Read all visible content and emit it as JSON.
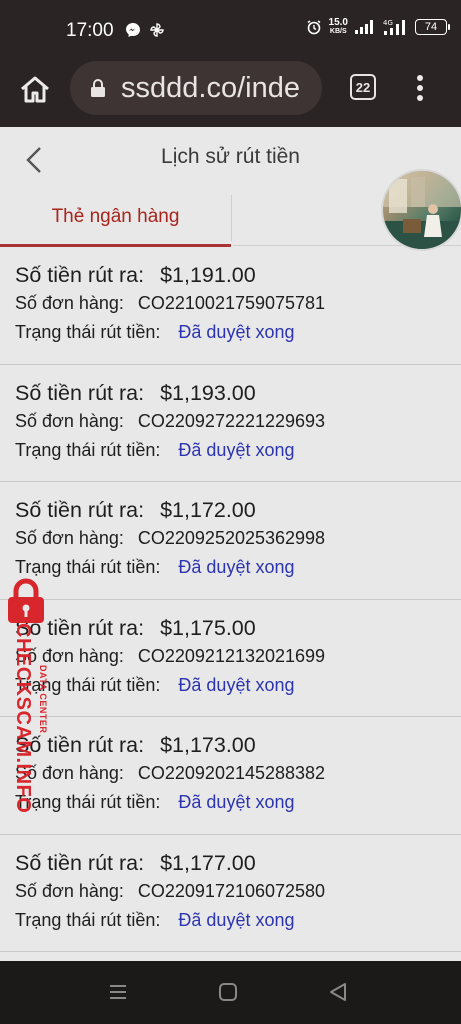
{
  "status_bar": {
    "time": "17:00",
    "net_speed": "15.0",
    "net_unit": "KB/S",
    "battery": "74"
  },
  "browser": {
    "url": "ssddd.co/inde",
    "tab_count": "22"
  },
  "header": {
    "title": "Lịch sử rút tiền"
  },
  "tabs": [
    {
      "label": "Thẻ ngân hàng",
      "active": true
    }
  ],
  "labels": {
    "amount": "Số tiền rút ra:",
    "order": "Số đơn hàng:",
    "status": "Trạng thái rút tiền:"
  },
  "withdrawals": [
    {
      "amount": "$1,191.00",
      "order": "CO2210021759075781",
      "status": "Đã duyệt xong"
    },
    {
      "amount": "$1,193.00",
      "order": "CO2209272221229693",
      "status": "Đã duyệt xong"
    },
    {
      "amount": "$1,172.00",
      "order": "CO2209252025362998",
      "status": "Đã duyệt xong"
    },
    {
      "amount": "$1,175.00",
      "order": "CO2209212132021699",
      "status": "Đã duyệt xong"
    },
    {
      "amount": "$1,173.00",
      "order": "CO2209202145288382",
      "status": "Đã duyệt xong"
    },
    {
      "amount": "$1,177.00",
      "order": "CO2209172106072580",
      "status": "Đã duyệt xong"
    }
  ],
  "watermark": {
    "main": "CHECKSCAM.INFO",
    "sub": "DATA CENTER"
  },
  "colors": {
    "accent_red": "#a8241c",
    "status_blue": "#2c34b0",
    "watermark_red": "#d8262d"
  }
}
